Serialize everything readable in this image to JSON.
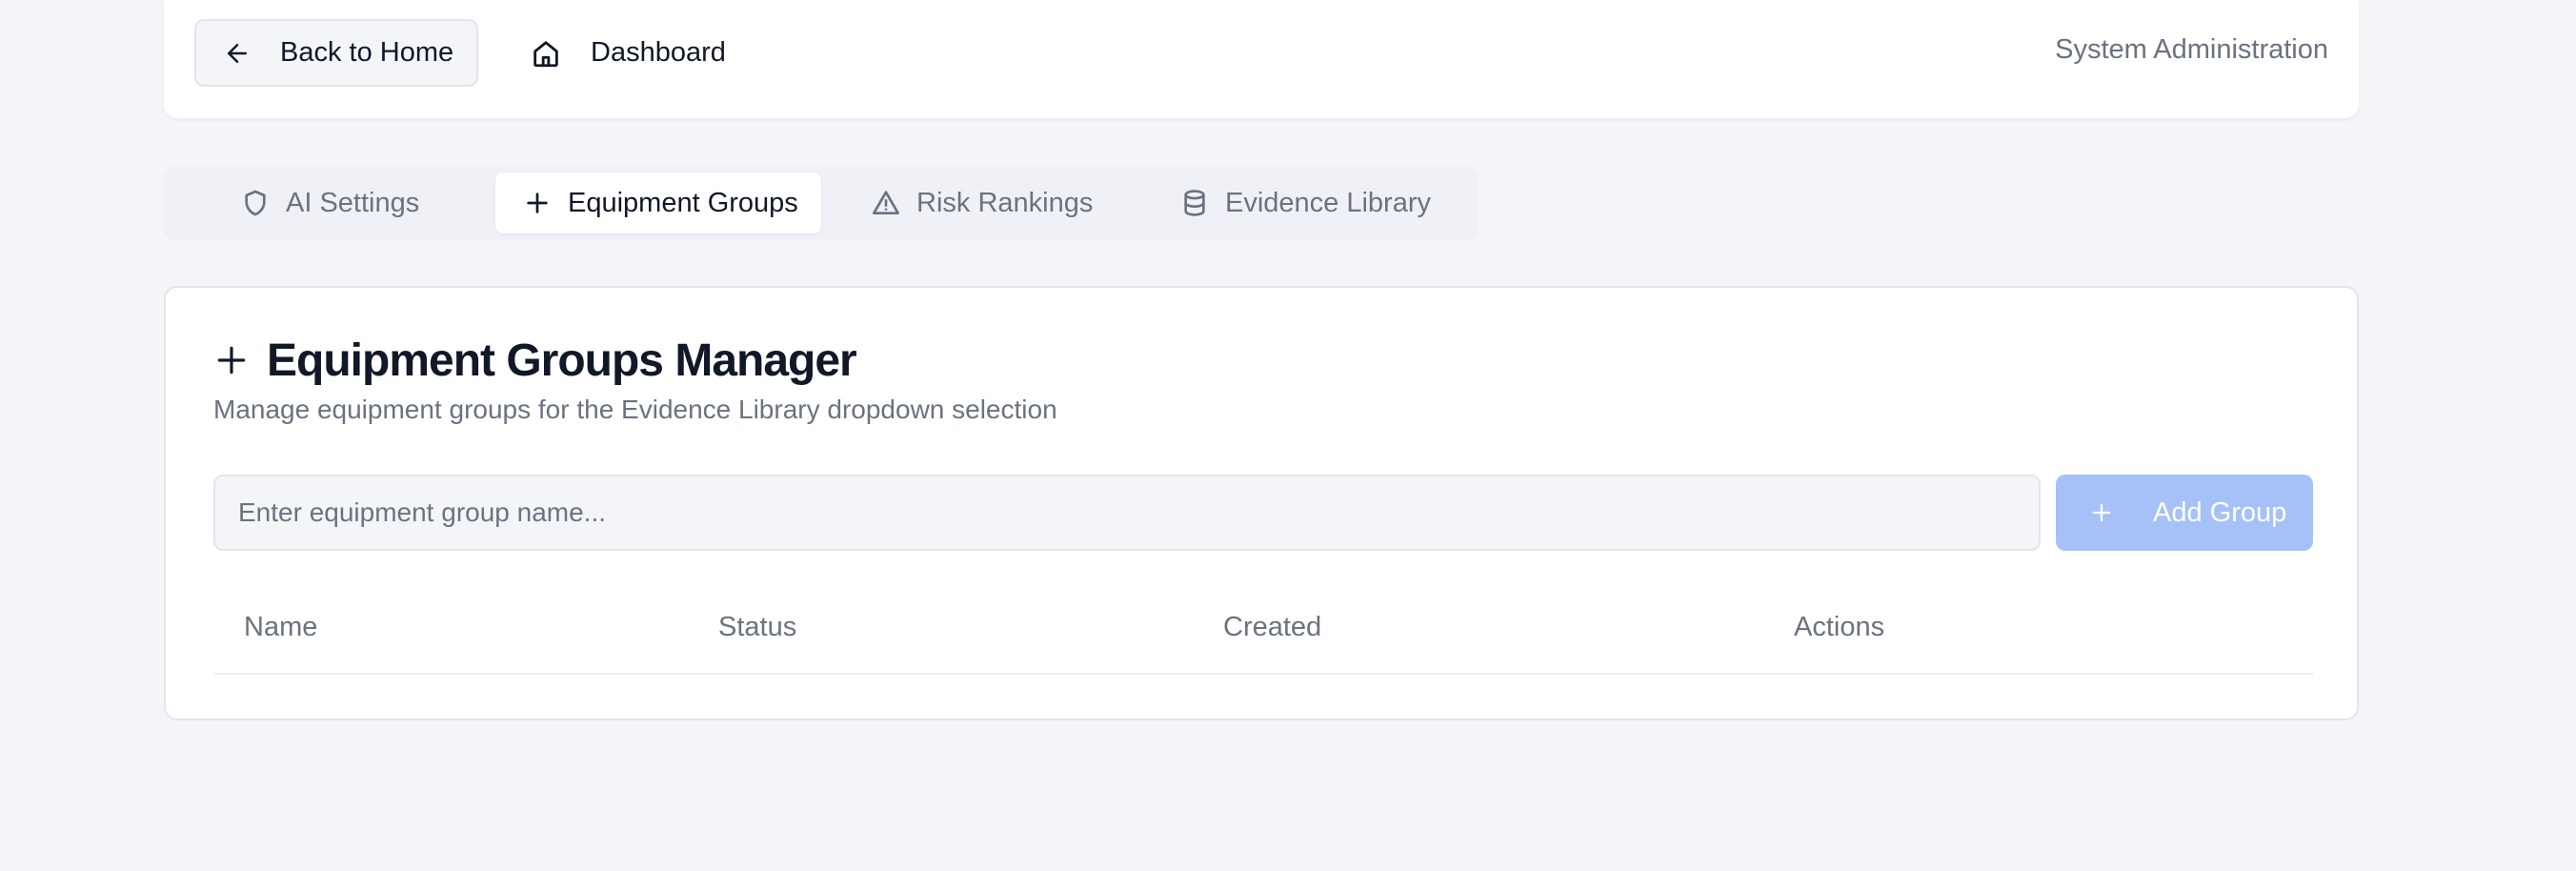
{
  "topbar": {
    "back_label": "Back to Home",
    "dashboard_label": "Dashboard",
    "section_label": "System Administration"
  },
  "tabs": [
    {
      "label": "AI Settings",
      "icon": "shield-icon",
      "active": false
    },
    {
      "label": "Equipment Groups",
      "icon": "plus-icon",
      "active": true
    },
    {
      "label": "Risk Rankings",
      "icon": "warning-triangle-icon",
      "active": false
    },
    {
      "label": "Evidence Library",
      "icon": "database-icon",
      "active": false
    }
  ],
  "card": {
    "title": "Equipment Groups Manager",
    "description": "Manage equipment groups for the Evidence Library dropdown selection",
    "input_value": "",
    "input_placeholder": "Enter equipment group name...",
    "add_label": "Add Group"
  },
  "table": {
    "columns": [
      "Name",
      "Status",
      "Created",
      "Actions"
    ],
    "rows": []
  },
  "colors": {
    "page_background": "#f4f5f9",
    "add_button_disabled": "#a6c0f8",
    "muted_text": "#6b7280",
    "primary_text": "#111827"
  }
}
